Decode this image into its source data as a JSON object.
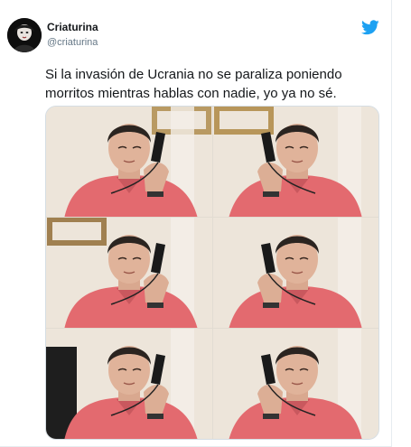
{
  "tweet": {
    "display_name": "Criaturina",
    "handle": "@criaturina",
    "text": "Si la invasión de Ucrania no se paraliza poniendo morritos mientras hablas con nadie, yo ya no sé."
  },
  "icons": {
    "avatar": "profile-avatar",
    "brand": "twitter-bird-icon"
  },
  "colors": {
    "shirt": "#e36a6f",
    "wall": "#ede5da",
    "brand_blue": "#1da1f2",
    "handle_gray": "#657786"
  },
  "media": {
    "photos": [
      {
        "variant": "a",
        "rings": [
          "#b99a63"
        ]
      },
      {
        "variant": "b",
        "rings": [
          "#b8965a"
        ]
      },
      {
        "variant": "c",
        "rings": [
          "#a08050"
        ]
      },
      {
        "variant": "d",
        "rings": []
      },
      {
        "variant": "e",
        "rings": []
      },
      {
        "variant": "f",
        "rings": []
      }
    ]
  }
}
